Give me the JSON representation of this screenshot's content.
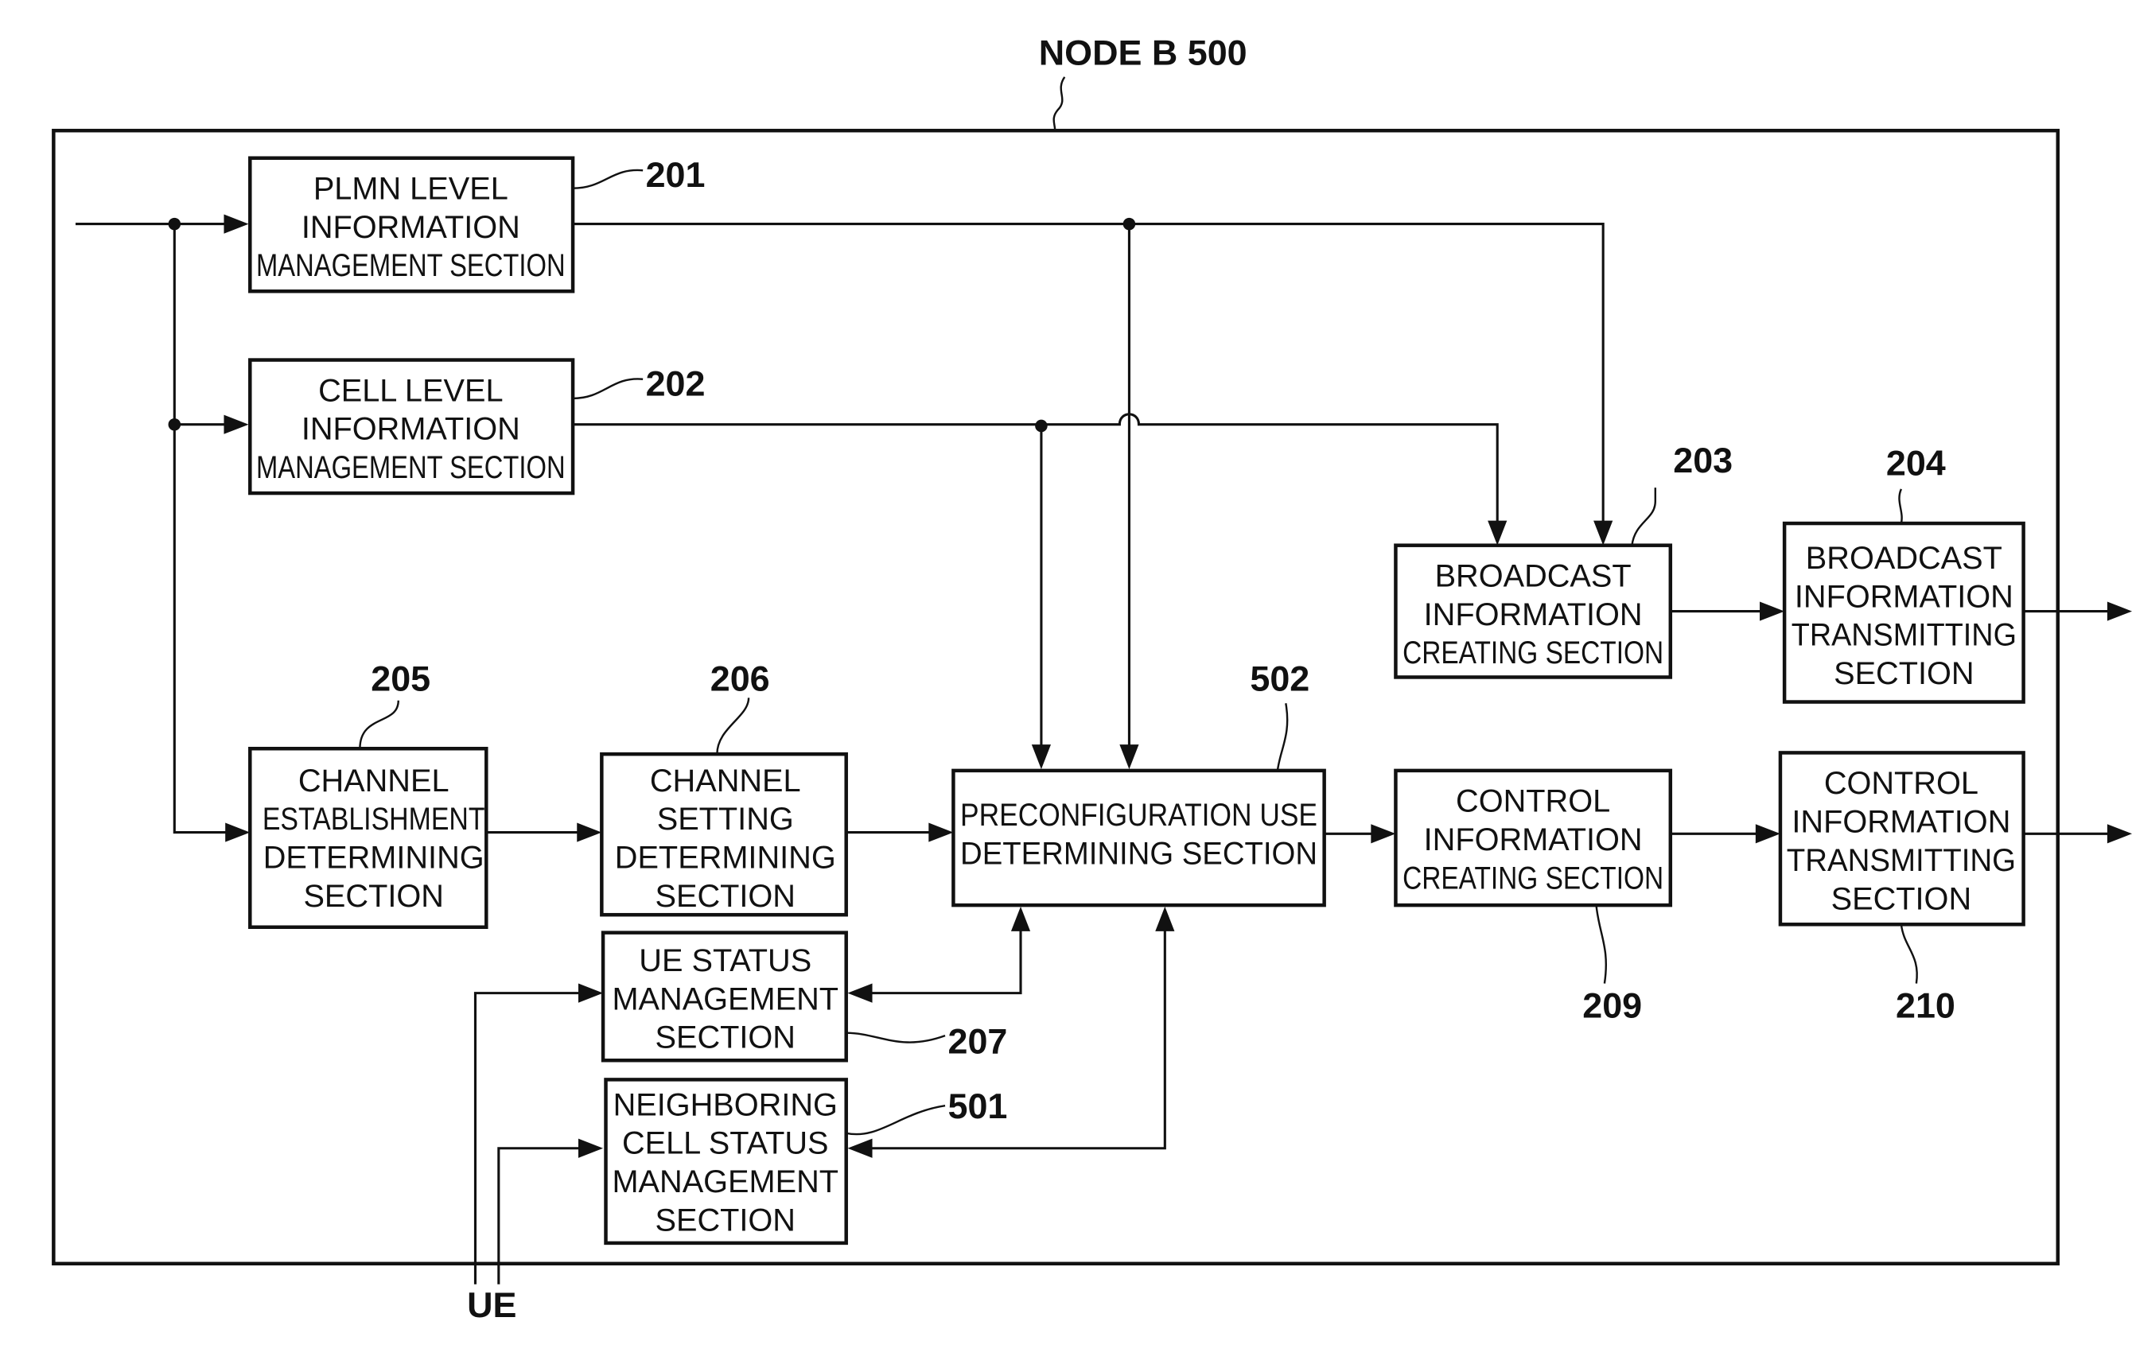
{
  "title": "NODE B 500",
  "external": {
    "ue_label": "UE"
  },
  "blocks": [
    {
      "id": "201",
      "ref": "201",
      "lines": [
        "PLMN LEVEL",
        "INFORMATION",
        "MANAGEMENT SECTION"
      ]
    },
    {
      "id": "202",
      "ref": "202",
      "lines": [
        "CELL LEVEL",
        "INFORMATION",
        "MANAGEMENT SECTION"
      ]
    },
    {
      "id": "203",
      "ref": "203",
      "lines": [
        "BROADCAST",
        "INFORMATION",
        "CREATING SECTION"
      ]
    },
    {
      "id": "204",
      "ref": "204",
      "lines": [
        "BROADCAST",
        "INFORMATION",
        "TRANSMITTING",
        "SECTION"
      ]
    },
    {
      "id": "205",
      "ref": "205",
      "lines": [
        "CHANNEL",
        "ESTABLISHMENT",
        "DETERMINING",
        "SECTION"
      ]
    },
    {
      "id": "206",
      "ref": "206",
      "lines": [
        "CHANNEL",
        "SETTING",
        "DETERMINING",
        "SECTION"
      ]
    },
    {
      "id": "502",
      "ref": "502",
      "lines": [
        "PRECONFIGURATION USE",
        "DETERMINING SECTION"
      ]
    },
    {
      "id": "209",
      "ref": "209",
      "lines": [
        "CONTROL",
        "INFORMATION",
        "CREATING SECTION"
      ]
    },
    {
      "id": "210",
      "ref": "210",
      "lines": [
        "CONTROL",
        "INFORMATION",
        "TRANSMITTING",
        "SECTION"
      ]
    },
    {
      "id": "207",
      "ref": "207",
      "lines": [
        "UE STATUS",
        "MANAGEMENT",
        "SECTION"
      ]
    },
    {
      "id": "501",
      "ref": "501",
      "lines": [
        "NEIGHBORING",
        "CELL STATUS",
        "MANAGEMENT",
        "SECTION"
      ]
    }
  ]
}
